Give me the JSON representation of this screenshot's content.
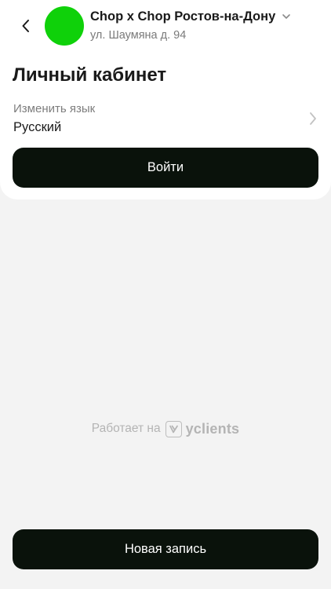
{
  "header": {
    "company_name": "Chop x Chop Ростов-на-Дону",
    "address": "ул. Шаумяна д. 94",
    "avatar_color": "#0fd10a",
    "back_icon": "chevron-left-icon",
    "dropdown_icon": "chevron-down-icon"
  },
  "page": {
    "title": "Личный кабинет"
  },
  "language": {
    "label": "Изменить язык",
    "value": "Русский",
    "icon": "chevron-right-icon"
  },
  "buttons": {
    "login": "Войти",
    "new_booking": "Новая запись"
  },
  "footer": {
    "powered_text": "Работает на",
    "brand": "yclients"
  },
  "colors": {
    "background": "#f3f3f3",
    "card": "#ffffff",
    "button": "#0a120b",
    "muted_text": "#7d7d7d"
  }
}
